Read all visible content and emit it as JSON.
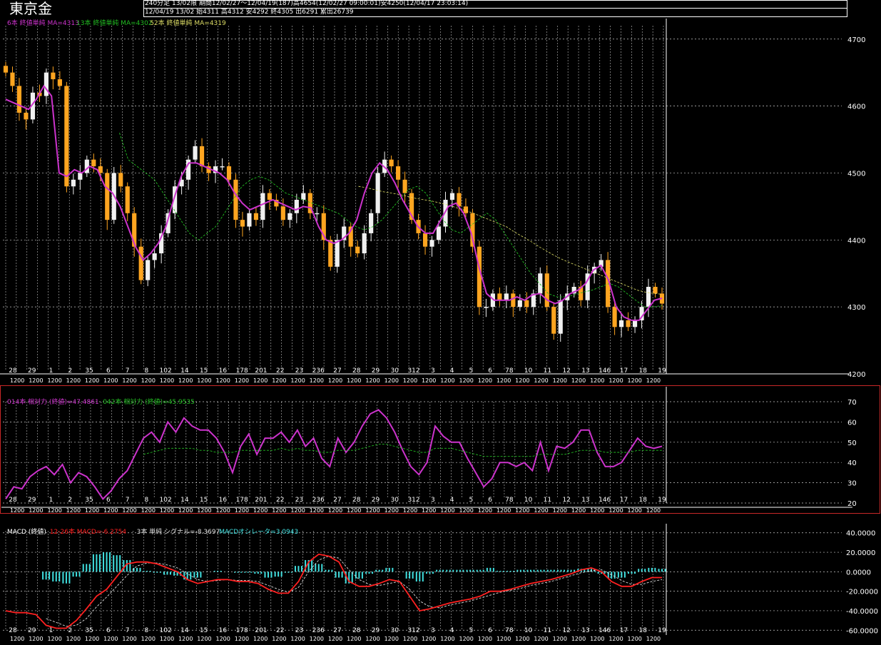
{
  "header": {
    "title": "東京金",
    "line1": "240分足 13/02限 期間12/02/27～12/04/19(187)高4654(12/02/27 09:00:01)安4250(12/04/17 23:03:14)",
    "line2": "12/04/19 13/02 始4311 高4312 安4292 終4305 出6291 累出26739"
  },
  "colors": {
    "up": "#f0f0f0",
    "down": "#ffa520",
    "ma1": "#cc33cc",
    "ma2": "#22bb22",
    "ma3": "#dddd66",
    "rsi1": "#cc33cc",
    "rsi2": "#22bb22",
    "macd": "#ff2020",
    "signal": "#dddddd",
    "hist": "#40e0e0",
    "grid": "#ffffff",
    "frame": "#c82828"
  },
  "date_labels": [
    "28",
    "29",
    "1",
    "2",
    "35",
    "6",
    "7",
    "8",
    "102",
    "14",
    "15",
    "16",
    "178",
    "201",
    "22",
    "23",
    "236",
    "27",
    "28",
    "29",
    "30",
    "312",
    "3",
    "4",
    "5",
    "6",
    "78",
    "10",
    "11",
    "12",
    "13",
    "146",
    "17",
    "18",
    "19"
  ],
  "time_labels": [
    "1200",
    "1200",
    "1200",
    "1200",
    "1200",
    "1200",
    "1200",
    "1200",
    "1200",
    "1200",
    "1200",
    "1200",
    "1200",
    "1200",
    "1200",
    "1200",
    "1200",
    "1200",
    "1200",
    "1200",
    "1200",
    "1200",
    "1200",
    "1200",
    "1200",
    "1200",
    "1200",
    "1200",
    "1200",
    "1200",
    "1200",
    "1200",
    "1200",
    "1200",
    "1200"
  ],
  "chart_data": [
    {
      "type": "candlestick",
      "legend": [
        {
          "text": "6本 終値単純 MA=4313",
          "color": "#cc33cc"
        },
        {
          "text": "13本 終値単純 MA=4302",
          "color": "#22bb22"
        },
        {
          "text": "52本 終値単純 MA=4319",
          "color": "#dddd66"
        }
      ],
      "ylim": [
        4200,
        4720
      ],
      "yticks": [
        4700,
        4600,
        4500,
        4400,
        4300,
        4200
      ],
      "closes": [
        4650,
        4630,
        4590,
        4580,
        4620,
        4615,
        4650,
        4640,
        4630,
        4480,
        4490,
        4500,
        4520,
        4510,
        4500,
        4430,
        4500,
        4480,
        4440,
        4390,
        4340,
        4370,
        4380,
        4410,
        4440,
        4480,
        4490,
        4520,
        4540,
        4510,
        4500,
        4510,
        4510,
        4490,
        4430,
        4420,
        4440,
        4430,
        4470,
        4460,
        4450,
        4430,
        4440,
        4460,
        4470,
        4440,
        4440,
        4400,
        4360,
        4400,
        4420,
        4390,
        4380,
        4410,
        4440,
        4500,
        4520,
        4510,
        4490,
        4470,
        4430,
        4410,
        4390,
        4400,
        4420,
        4460,
        4470,
        4450,
        4440,
        4390,
        4300,
        4300,
        4320,
        4310,
        4320,
        4300,
        4310,
        4300,
        4320,
        4350,
        4300,
        4260,
        4310,
        4320,
        4330,
        4310,
        4350,
        4360,
        4370,
        4300,
        4270,
        4280,
        4270,
        4280,
        4300,
        4330,
        4320,
        4305
      ],
      "ma1": [
        4610,
        4605,
        4600,
        4595,
        4610,
        4630,
        4615,
        4500,
        4495,
        4505,
        4500,
        4510,
        4505,
        4480,
        4470,
        4450,
        4420,
        4390,
        4370,
        4380,
        4395,
        4420,
        4460,
        4495,
        4515,
        4515,
        4510,
        4505,
        4500,
        4490,
        4470,
        4455,
        4445,
        4450,
        4455,
        4460,
        4455,
        4450,
        4445,
        4450,
        4448,
        4420,
        4400,
        4395,
        4400,
        4410,
        4430,
        4470,
        4500,
        4515,
        4505,
        4485,
        4460,
        4440,
        4420,
        4410,
        4410,
        4430,
        4450,
        4455,
        4440,
        4410,
        4360,
        4320,
        4310,
        4310,
        4310,
        4315,
        4310,
        4318,
        4320,
        4310,
        4305,
        4310,
        4320,
        4325,
        4335,
        4355,
        4362,
        4340,
        4300,
        4285,
        4280,
        4280,
        4295,
        4310,
        4313
      ],
      "ma2": [
        null,
        null,
        null,
        null,
        null,
        null,
        null,
        null,
        null,
        null,
        null,
        null,
        null,
        4560,
        4520,
        4510,
        4500,
        4490,
        4470,
        4450,
        4430,
        4410,
        4400,
        4410,
        4420,
        4440,
        4460,
        4480,
        4490,
        4495,
        4490,
        4480,
        4470,
        4465,
        4460,
        4455,
        4450,
        4445,
        4440,
        4430,
        4420,
        4415,
        4420,
        4430,
        4445,
        4460,
        4475,
        4480,
        4470,
        4450,
        4430,
        4415,
        4410,
        4420,
        4430,
        4440,
        4430,
        4410,
        4390,
        4370,
        4350,
        4335,
        4320,
        4315,
        4315,
        4318,
        4322,
        4325,
        4330,
        4335,
        4330,
        4320,
        4310,
        4300,
        4300,
        4302
      ],
      "ma3": [
        null,
        null,
        null,
        null,
        null,
        null,
        null,
        null,
        null,
        null,
        null,
        null,
        null,
        null,
        null,
        null,
        null,
        null,
        null,
        null,
        null,
        null,
        null,
        null,
        null,
        null,
        null,
        null,
        null,
        null,
        null,
        null,
        null,
        null,
        null,
        null,
        null,
        null,
        null,
        null,
        null,
        null,
        null,
        4480,
        4478,
        4475,
        4472,
        4470,
        4468,
        4465,
        4462,
        4460,
        4458,
        4455,
        4452,
        4448,
        4444,
        4440,
        4435,
        4430,
        4425,
        4420,
        4412,
        4405,
        4398,
        4390,
        4383,
        4376,
        4370,
        4365,
        4360,
        4355,
        4350,
        4345,
        4340,
        4335,
        4330,
        4325,
        4322,
        4320,
        4319
      ]
    },
    {
      "type": "line",
      "legend": [
        {
          "text": "014本 相対力 (終値)=47.4861",
          "color": "#cc33cc"
        },
        {
          "text": "042本 相対力 (終値)=45.9535",
          "color": "#22bb22"
        }
      ],
      "ylim": [
        20,
        70
      ],
      "yticks": [
        70,
        60,
        50,
        40,
        30,
        20
      ],
      "series": [
        {
          "name": "014本 相対力 (終値)",
          "values": [
            22,
            28,
            27,
            33,
            36,
            38,
            34,
            39,
            30,
            35,
            33,
            28,
            22,
            26,
            32,
            36,
            44,
            52,
            55,
            50,
            60,
            55,
            62,
            58,
            56,
            56,
            52,
            45,
            35,
            48,
            54,
            44,
            52,
            52,
            55,
            50,
            56,
            48,
            52,
            42,
            38,
            52,
            45,
            50,
            58,
            64,
            66,
            62,
            55,
            46,
            38,
            34,
            40,
            58,
            53,
            50,
            50,
            42,
            35,
            28,
            32,
            40,
            40,
            38,
            40,
            36,
            50,
            36,
            48,
            47,
            50,
            56,
            56,
            45,
            38,
            38,
            40,
            46,
            52,
            48,
            47,
            48
          ]
        },
        {
          "name": "042本 相対力 (終値)",
          "values": [
            null,
            null,
            null,
            null,
            null,
            null,
            null,
            null,
            null,
            null,
            null,
            null,
            null,
            null,
            null,
            null,
            null,
            44,
            45,
            46,
            47,
            47,
            47,
            47,
            46,
            46,
            45,
            45,
            45,
            46,
            46,
            46,
            46,
            46,
            47,
            46,
            47,
            46,
            46,
            45,
            45,
            46,
            46,
            46,
            47,
            48,
            49,
            49,
            48,
            47,
            46,
            45,
            45,
            47,
            47,
            47,
            46,
            45,
            44,
            43,
            43,
            43,
            43,
            43,
            43,
            43,
            44,
            44,
            44,
            44,
            45,
            46,
            46,
            46,
            45,
            45,
            45,
            45,
            46,
            46,
            46,
            46
          ]
        }
      ]
    },
    {
      "type": "bar",
      "legend": [
        {
          "text": "MACD (終値)",
          "color": "#ffffff"
        },
        {
          "text": "12-26本 MACD=-6.2754",
          "color": "#ff2020"
        },
        {
          "text": "3本 単純 シグナル=-8.3697",
          "color": "#dddddd"
        },
        {
          "text": "MACDオシレータ=3.0943",
          "color": "#40e0e0"
        }
      ],
      "ylim": [
        -62,
        42
      ],
      "yticks": [
        "40.0000",
        "20.0000",
        "0.0000",
        "-20.0000",
        "-40.0000",
        "-60.0000"
      ],
      "series": [
        {
          "name": "MACD",
          "values": [
            -40,
            -42,
            -42,
            -44,
            -55,
            -58,
            -58,
            -50,
            -38,
            -25,
            -18,
            -5,
            8,
            10,
            10,
            8,
            4,
            0,
            -8,
            -12,
            -10,
            -8,
            -8,
            -10,
            -10,
            -12,
            -18,
            -22,
            -22,
            -10,
            10,
            18,
            16,
            10,
            -10,
            -15,
            -15,
            -12,
            -8,
            -10,
            -25,
            -40,
            -38,
            -35,
            -32,
            -30,
            -28,
            -25,
            -20,
            -20,
            -18,
            -15,
            -12,
            -10,
            -8,
            -5,
            -2,
            2,
            4,
            0,
            -10,
            -15,
            -15,
            -10,
            -6,
            -6
          ]
        },
        {
          "name": "シグナル",
          "values": [
            null,
            null,
            null,
            null,
            -48,
            -52,
            -56,
            -55,
            -48,
            -36,
            -26,
            -15,
            -4,
            6,
            9,
            9,
            7,
            4,
            -2,
            -8,
            -10,
            -9,
            -8,
            -9,
            -9,
            -10,
            -14,
            -18,
            -21,
            -16,
            0,
            12,
            16,
            14,
            2,
            -8,
            -13,
            -14,
            -12,
            -10,
            -18,
            -30,
            -36,
            -37,
            -34,
            -32,
            -30,
            -27,
            -24,
            -21,
            -19,
            -17,
            -14,
            -12,
            -10,
            -7,
            -4,
            -1,
            1,
            2,
            -3,
            -9,
            -13,
            -13,
            -10,
            -8
          ]
        },
        {
          "name": "MACDオシレータ",
          "values": [
            null,
            null,
            null,
            null,
            -8,
            -10,
            -12,
            -5,
            8,
            18,
            20,
            17,
            12,
            4,
            1,
            -1,
            -3,
            -4,
            -8,
            -6,
            0,
            1,
            0,
            -1,
            -1,
            -2,
            -6,
            -5,
            -1,
            6,
            12,
            8,
            2,
            -6,
            -12,
            -7,
            -2,
            2,
            4,
            0,
            -7,
            -10,
            -2,
            2,
            2,
            2,
            2,
            2,
            4,
            1,
            1,
            2,
            2,
            2,
            2,
            2,
            2,
            3,
            3,
            -2,
            -7,
            -6,
            -2,
            3,
            4,
            3
          ]
        }
      ]
    }
  ]
}
